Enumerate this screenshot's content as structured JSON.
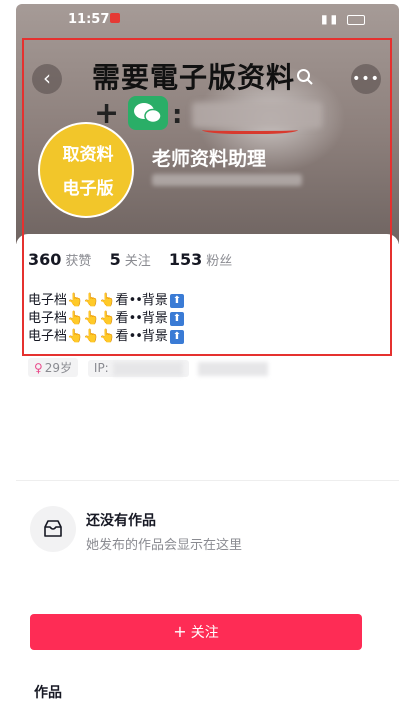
{
  "status_bar": {
    "time": "11:57"
  },
  "header": {
    "headline": "需要電子版资料",
    "plus": "+",
    "colon": ":"
  },
  "avatar": {
    "line1": "取资料",
    "line2": "电子版"
  },
  "profile": {
    "name": "老师资料助理"
  },
  "stats": [
    {
      "value": "360",
      "label": "获赞"
    },
    {
      "value": "5",
      "label": "关注"
    },
    {
      "value": "153",
      "label": "粉丝"
    }
  ],
  "bio": {
    "line_prefix": "电子档👆👆👆看",
    "line_suffix": "背景",
    "dots": "••",
    "arrow": "⬆"
  },
  "tags": {
    "age": "29岁",
    "ip_label": "IP:"
  },
  "follow_button": {
    "plus": "+",
    "label": "关注"
  },
  "works": {
    "section_title": "作品",
    "empty_title": "还没有作品",
    "empty_subtitle": "她发布的作品会显示在这里"
  },
  "colors": {
    "accent": "#fe2c55",
    "highlight": "#e5312f",
    "avatar_bg": "#f2c62a"
  }
}
